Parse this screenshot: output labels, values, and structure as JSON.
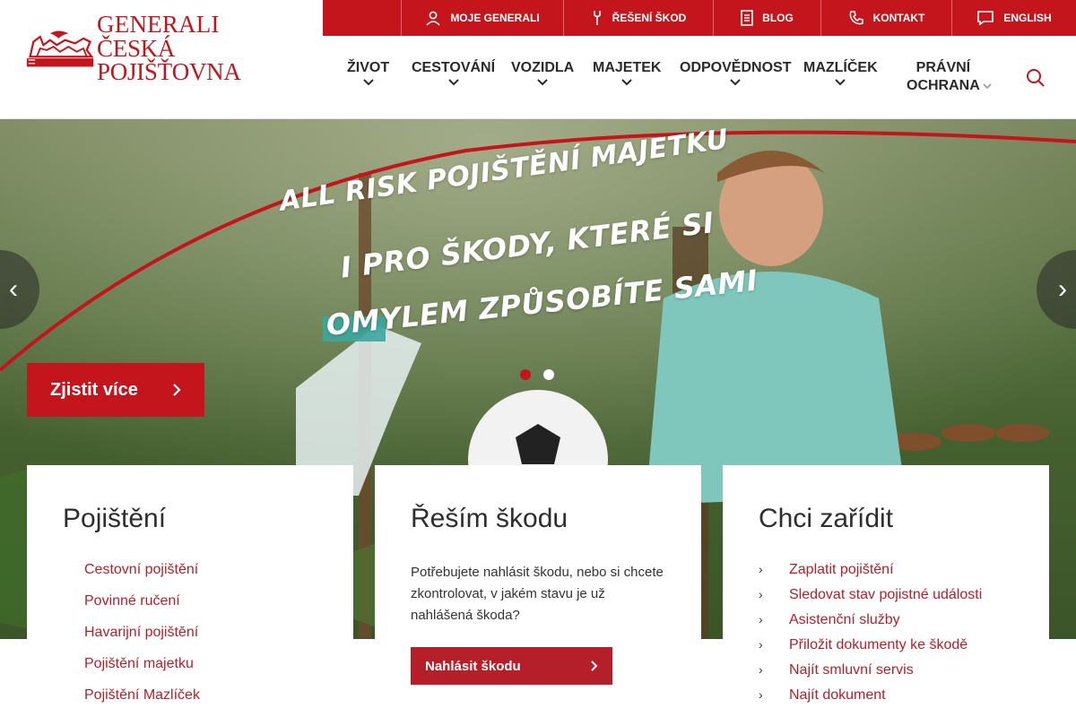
{
  "brand": {
    "line1": "GENERALI",
    "line2": "ČESKÁ POJIŠŤOVNA",
    "color": "#c4151c"
  },
  "topbar": {
    "items": [
      {
        "label": "MOJE GENERALI",
        "icon": "user-icon"
      },
      {
        "label": "ŘEŠENÍ ŠKOD",
        "icon": "wrench-icon"
      },
      {
        "label": "BLOG",
        "icon": "document-icon"
      },
      {
        "label": "KONTAKT",
        "icon": "phone-icon"
      },
      {
        "label": "ENGLISH",
        "icon": "chat-icon"
      }
    ]
  },
  "nav": {
    "items": [
      {
        "label": "ŽIVOT"
      },
      {
        "label": "CESTOVÁNÍ"
      },
      {
        "label": "VOZIDLA"
      },
      {
        "label": "MAJETEK"
      },
      {
        "label": "ODPOVĚDNOST"
      },
      {
        "label": "MAZLÍČEK"
      },
      {
        "label": "PRÁVNÍ",
        "label2": "OCHRANA"
      }
    ],
    "search_icon": "search-icon"
  },
  "hero": {
    "headline": [
      "ALL RISK POJIŠTĚNÍ MAJETKU",
      "I PRO ŠKODY, KTERÉ SI",
      "OMYLEM ZPŮSOBÍTE SAMI"
    ],
    "cta_label": "Zjistit více",
    "prev_label": "‹",
    "next_label": "›",
    "slides_total": 2,
    "slide_active": 1
  },
  "cards": {
    "insurance": {
      "title": "Pojištění",
      "links": [
        "Cestovní pojištění",
        "Povinné ručení",
        "Havarijní pojištění",
        "Pojištění majetku",
        "Pojištění Mazlíček"
      ]
    },
    "claims": {
      "title": "Řeším škodu",
      "description": "Potřebujete nahlásit škodu, nebo si chcete zkontrolovat, v jakém stavu je už nahlášená škoda?",
      "button_label": "Nahlásit škodu"
    },
    "services": {
      "title": "Chci zařídit",
      "links": [
        "Zaplatit pojištění",
        "Sledovat stav pojistné události",
        "Asistenční služby",
        "Přiložit dokumenty ke škodě",
        "Najít smluvní servis",
        "Najít dokument"
      ]
    }
  }
}
